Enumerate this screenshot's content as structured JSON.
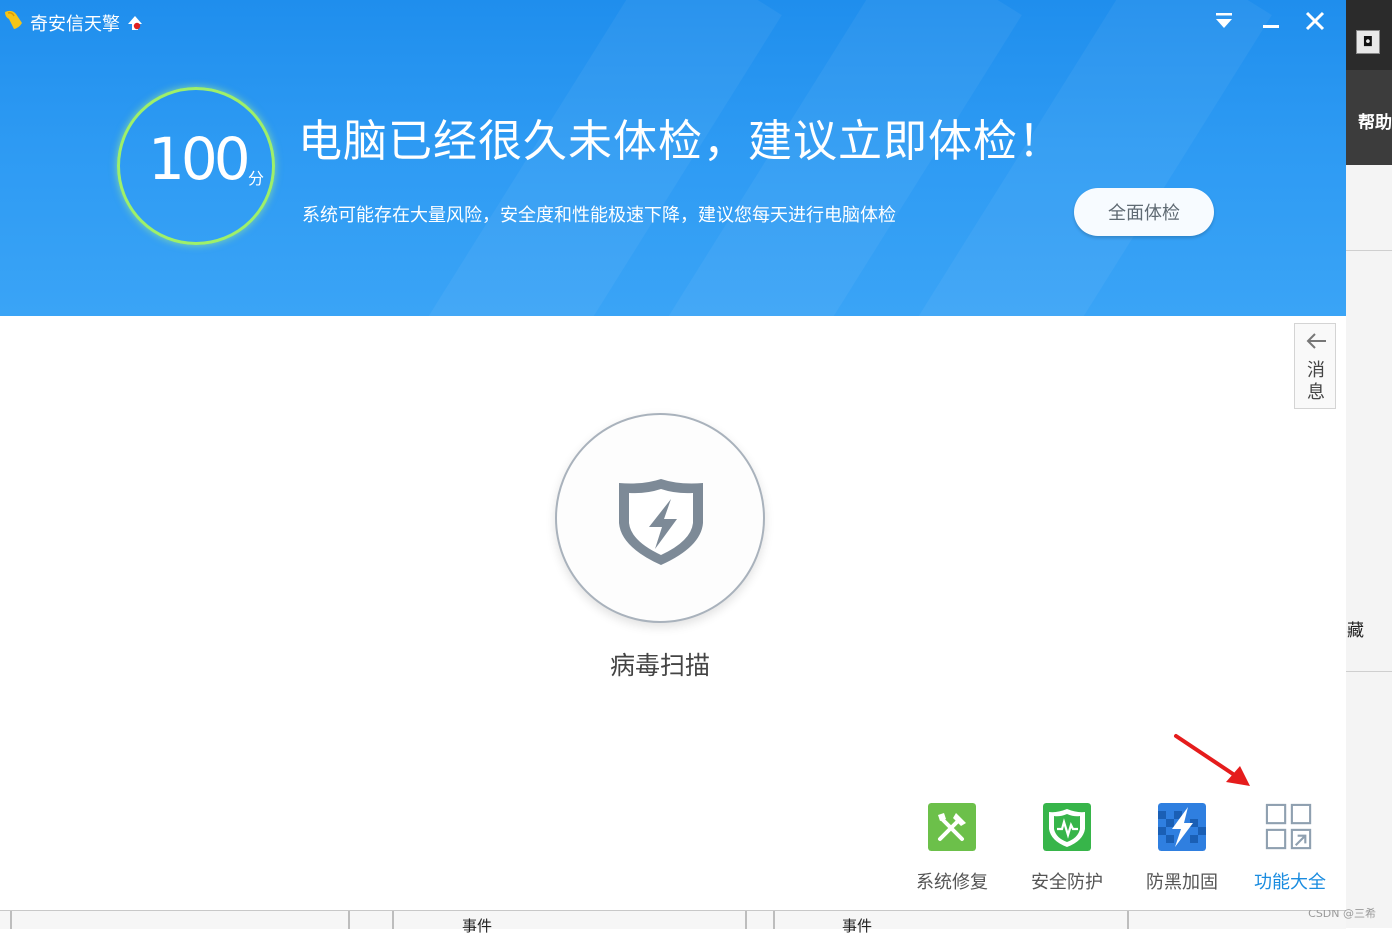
{
  "window": {
    "title": "奇安信天擎"
  },
  "header": {
    "score": "100",
    "score_unit": "分",
    "headline": "电脑已经很久未体检，建议立即体检！",
    "subline": "系统可能存在大量风险，安全度和性能极速下降，建议您每天进行电脑体检",
    "check_button": "全面体检"
  },
  "side_tab": {
    "label": "消息"
  },
  "main": {
    "scan_label": "病毒扫描"
  },
  "tools": [
    {
      "label": "系统修复",
      "icon": "tools-icon",
      "color": "#6cc04a"
    },
    {
      "label": "安全防护",
      "icon": "shield-pulse-icon",
      "color": "#37b54a"
    },
    {
      "label": "防黑加固",
      "icon": "lightning-icon",
      "color": "#2f7fe0"
    },
    {
      "label": "功能大全",
      "icon": "grid-icon",
      "color": "#1a8ce0"
    }
  ],
  "background_app": {
    "help_label": "帮助",
    "partial_label": "藏",
    "table_header_1": "事件",
    "table_header_2": "事件"
  },
  "watermark": "CSDN @三希"
}
